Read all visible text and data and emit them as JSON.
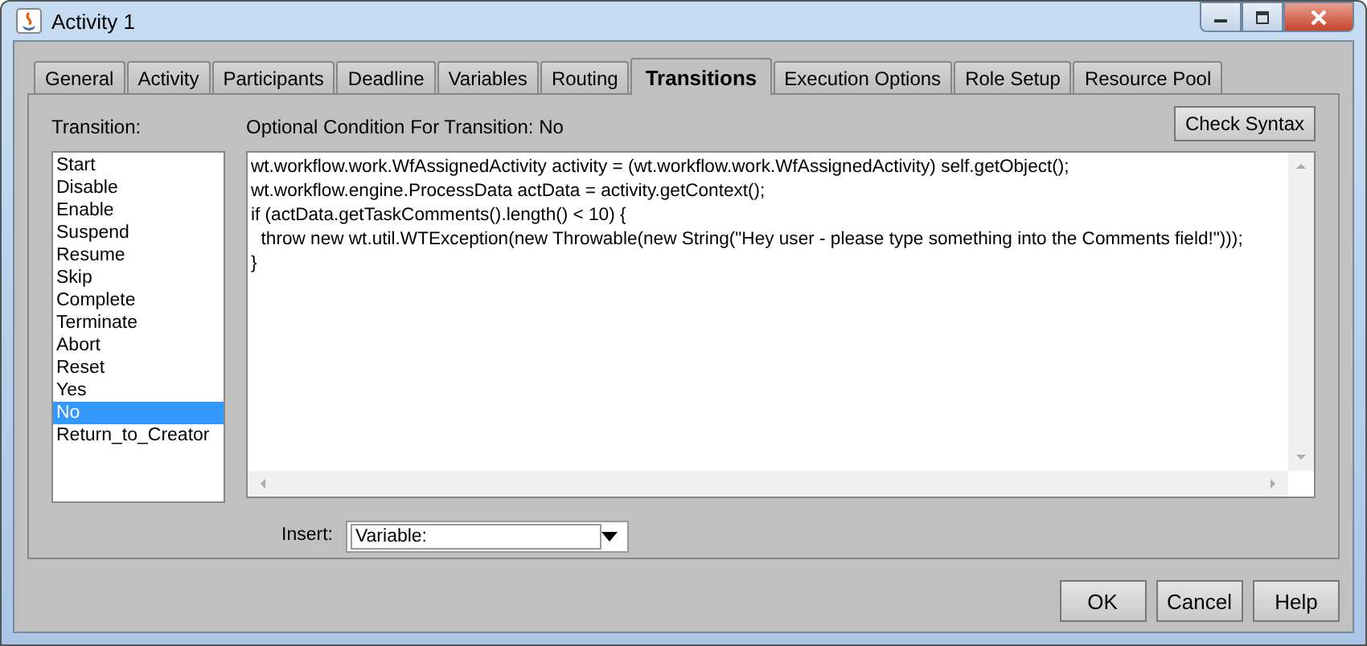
{
  "window": {
    "title": "Activity 1"
  },
  "tabs": [
    {
      "label": "General",
      "selected": false
    },
    {
      "label": "Activity",
      "selected": false
    },
    {
      "label": "Participants",
      "selected": false
    },
    {
      "label": "Deadline",
      "selected": false
    },
    {
      "label": "Variables",
      "selected": false
    },
    {
      "label": "Routing",
      "selected": false
    },
    {
      "label": "Transitions",
      "selected": true
    },
    {
      "label": "Execution Options",
      "selected": false
    },
    {
      "label": "Role Setup",
      "selected": false
    },
    {
      "label": "Resource Pool",
      "selected": false
    }
  ],
  "transition_label": "Transition:",
  "transitions": [
    {
      "label": "Start",
      "selected": false
    },
    {
      "label": "Disable",
      "selected": false
    },
    {
      "label": "Enable",
      "selected": false
    },
    {
      "label": "Suspend",
      "selected": false
    },
    {
      "label": "Resume",
      "selected": false
    },
    {
      "label": "Skip",
      "selected": false
    },
    {
      "label": "Complete",
      "selected": false
    },
    {
      "label": "Terminate",
      "selected": false
    },
    {
      "label": "Abort",
      "selected": false
    },
    {
      "label": "Reset",
      "selected": false
    },
    {
      "label": "Yes",
      "selected": false
    },
    {
      "label": "No",
      "selected": true
    },
    {
      "label": "Return_to_Creator",
      "selected": false
    }
  ],
  "condition_label": "Optional Condition For Transition: No",
  "check_syntax_button": "Check Syntax",
  "code_lines": [
    "wt.workflow.work.WfAssignedActivity activity = (wt.workflow.work.WfAssignedActivity) self.getObject();",
    "wt.workflow.engine.ProcessData actData = activity.getContext();",
    "if (actData.getTaskComments().length() < 10) {",
    "  throw new wt.util.WTException(new Throwable(new String(\"Hey user - please type something into the Comments field!\")));",
    "}"
  ],
  "insert": {
    "label": "Insert:",
    "value": "Variable:"
  },
  "buttons": [
    "OK",
    "Cancel",
    "Help"
  ]
}
